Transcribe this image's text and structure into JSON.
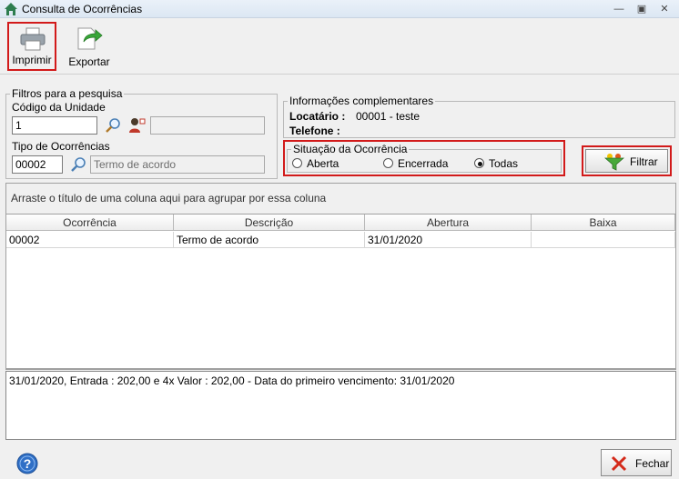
{
  "window": {
    "title": "Consulta de Ocorrências",
    "icon": "home-icon",
    "controls": [
      "minimize-icon",
      "restore-icon",
      "close-icon"
    ]
  },
  "toolbar": {
    "print_label": "Imprimir",
    "export_label": "Exportar",
    "print_icon": "printer-icon",
    "export_icon": "export-icon"
  },
  "filters": {
    "legend": "Filtros para a pesquisa",
    "unit_code_label": "Código da Unidade",
    "unit_code_value": "1",
    "unit_name_value": "",
    "occurrence_type_label": "Tipo de Ocorrências",
    "occurrence_type_code": "00002",
    "occurrence_type_name": "Termo de acordo"
  },
  "info": {
    "legend": "Informações complementares",
    "tenant_label": "Locatário :",
    "tenant_value": "00001 - teste",
    "phone_label": "Telefone :",
    "phone_value": ""
  },
  "status": {
    "legend": "Situação da Ocorrência",
    "options": [
      "Aberta",
      "Encerrada",
      "Todas"
    ],
    "selected": "Todas"
  },
  "filter_button": {
    "label": "Filtrar",
    "icon": "funnel-icon"
  },
  "grid": {
    "group_hint": "Arraste o título de uma coluna aqui para agrupar por essa coluna",
    "columns": [
      "Ocorrência",
      "Descrição",
      "Abertura",
      "Baixa"
    ],
    "rows": [
      [
        "00002",
        "Termo de acordo",
        "31/01/2020",
        ""
      ]
    ]
  },
  "notes": {
    "text": "31/01/2020, Entrada : 202,00 e 4x  Valor : 202,00 - Data do primeiro vencimento: 31/01/2020"
  },
  "footer": {
    "help_icon": "help-icon",
    "close_label": "Fechar",
    "close_icon": "close-x-icon"
  },
  "colors": {
    "highlight_border": "#d21a1a",
    "window_bg": "#f0f0f0"
  }
}
